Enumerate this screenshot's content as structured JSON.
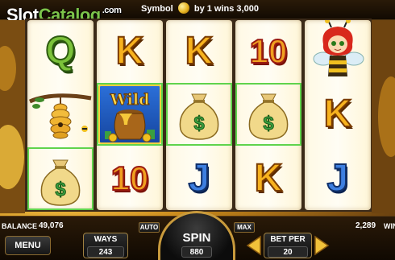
{
  "header": {
    "logo_main": "Slot",
    "logo_accent": "Catalog",
    "logo_suffix": ".com",
    "paytable_prefix": "Symbol",
    "paytable_suffix": "by 1 wins 3,000"
  },
  "reels": [
    [
      "Q",
      "beehive",
      "money-bag"
    ],
    [
      "K",
      "Wild",
      "10"
    ],
    [
      "K",
      "money-bag",
      "J"
    ],
    [
      "10",
      "money-bag",
      "K"
    ],
    [
      "bee-girl",
      "K",
      "J"
    ]
  ],
  "winning_cells": [
    [
      0,
      2
    ],
    [
      1,
      1
    ],
    [
      2,
      1
    ],
    [
      3,
      1
    ]
  ],
  "footer": {
    "balance_label": "BALANCE",
    "balance_value": "49,076",
    "win_value": "2,289",
    "win_label": "WIN",
    "menu_label": "MENU",
    "ways_label": "WAYS",
    "ways_value": "243",
    "auto_label": "AUTO",
    "max_label": "MAX",
    "spin_label": "SPIN",
    "spin_value": "880",
    "bet_label": "BET PER",
    "bet_value": "20"
  },
  "colors": {
    "win_highlight": "#5fd34c",
    "gold_frame": "#c89a3c"
  }
}
